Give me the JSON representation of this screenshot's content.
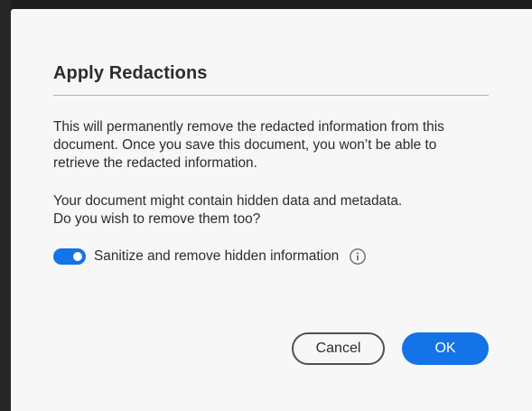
{
  "dialog": {
    "title": "Apply Redactions",
    "paragraph_1_line_1": "This will permanently remove the redacted information from this",
    "paragraph_1_line_2": "document. Once you save this document, you won’t be able to",
    "paragraph_1_line_3": "retrieve the redacted information.",
    "paragraph_2_line_1": "Your document might contain hidden data and metadata.",
    "paragraph_2_line_2": "Do you wish to remove them too?",
    "sanitize_toggle": {
      "label": "Sanitize and remove hidden information",
      "checked": true
    },
    "info_icon": "info-icon",
    "buttons": {
      "cancel_label": "Cancel",
      "ok_label": "OK"
    }
  },
  "colors": {
    "accent": "#1473e6",
    "dialog_background": "#f7f7f7",
    "text": "#2c2c2c"
  }
}
